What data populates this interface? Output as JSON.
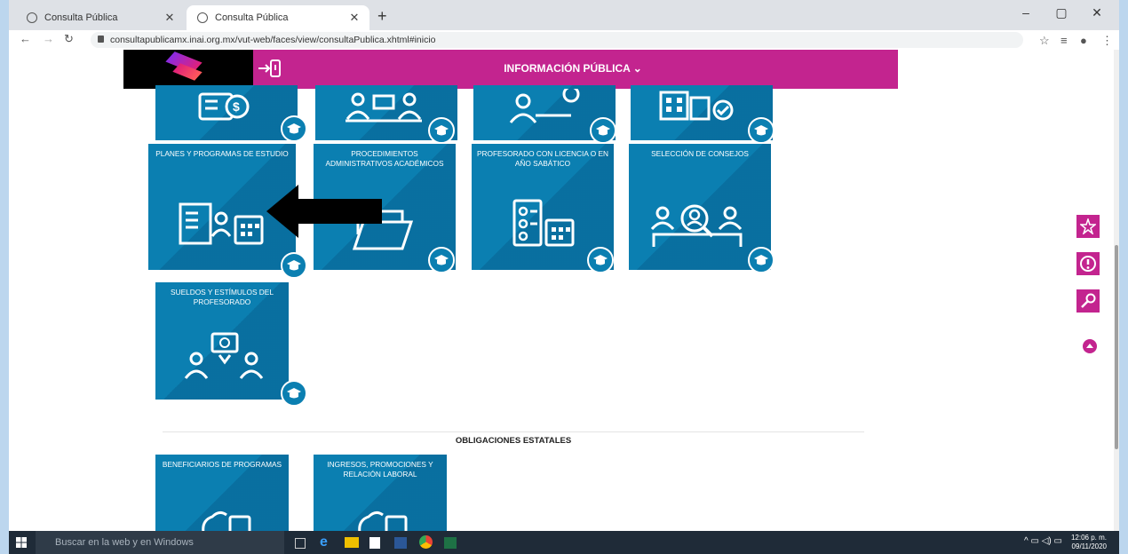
{
  "browser": {
    "tabs": [
      {
        "title": "Consulta Pública",
        "active": false
      },
      {
        "title": "Consulta Pública",
        "active": true
      }
    ],
    "new_tab": "+",
    "url": "consultapublicamx.inai.org.mx/vut-web/faces/view/consultaPublica.xhtml#inicio",
    "window_controls": [
      "–",
      "▢",
      "✕"
    ]
  },
  "header": {
    "title": "INFORMACIÓN PÚBLICA ⌄"
  },
  "cards": [
    {
      "label": ""
    },
    {
      "label": ""
    },
    {
      "label": ""
    },
    {
      "label": ""
    },
    {
      "label": "PLANES Y PROGRAMAS DE ESTUDIO"
    },
    {
      "label": "PROCEDIMIENTOS ADMINISTRATIVOS ACADÉMICOS"
    },
    {
      "label": "PROFESORADO CON LICENCIA O EN AÑO SABÁTICO"
    },
    {
      "label": "SELECCIÓN DE CONSEJOS"
    },
    {
      "label": "SUELDOS Y ESTÍMULOS DEL PROFESORADO"
    }
  ],
  "section": {
    "title": "OBLIGACIONES ESTATALES",
    "cards": [
      {
        "label": "BENEFICIARIOS DE PROGRAMAS"
      },
      {
        "label": "INGRESOS, PROMOCIONES Y RELACIÓN LABORAL"
      }
    ]
  },
  "taskbar": {
    "search_placeholder": "Buscar en la web y en Windows",
    "time": "12:06 p. m.",
    "date": "09/11/2020"
  },
  "colors": {
    "brand": "#c3248f",
    "card": "#0b7fb1"
  }
}
